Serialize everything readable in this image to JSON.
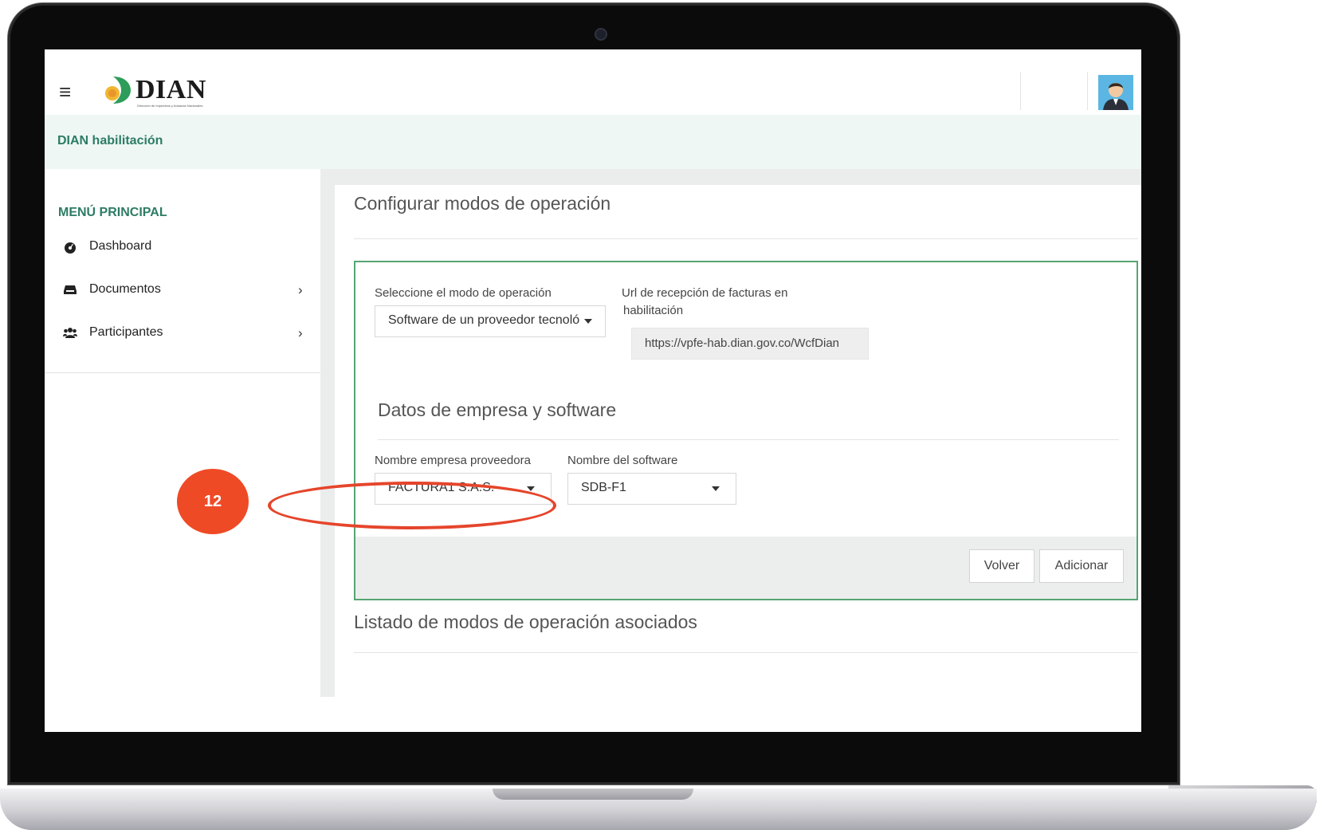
{
  "app": {
    "logo_text": "DIAN",
    "logo_subtitle": "Dirección de Impuestos y Aduanas Nacionales",
    "environment_title": "DIAN habilitación"
  },
  "sidebar": {
    "menu_title": "MENÚ PRINCIPAL",
    "items": [
      {
        "label": "Dashboard",
        "icon": "dashboard-icon",
        "has_submenu": false
      },
      {
        "label": "Documentos",
        "icon": "inbox-icon",
        "has_submenu": true
      },
      {
        "label": "Participantes",
        "icon": "users-icon",
        "has_submenu": true
      }
    ]
  },
  "main": {
    "page_title": "Configurar modos de operación",
    "form": {
      "mode_label": "Seleccione el modo de operación",
      "mode_value": "Software de un proveedor tecnoló",
      "url_label_line1": "Url de recepción de facturas en",
      "url_label_line2": "habilitación",
      "url_value": "https://vpfe-hab.dian.gov.co/WcfDian",
      "section_title": "Datos de empresa y software",
      "company_label": "Nombre empresa proveedora",
      "company_value": "FACTURA1 S.A.S.",
      "software_label": "Nombre del software",
      "software_value": "SDB-F1"
    },
    "buttons": {
      "back": "Volver",
      "add": "Adicionar"
    },
    "list_title": "Listado de modos de operación asociados"
  },
  "annotation": {
    "step_number": "12",
    "color": "#ef4a26"
  }
}
